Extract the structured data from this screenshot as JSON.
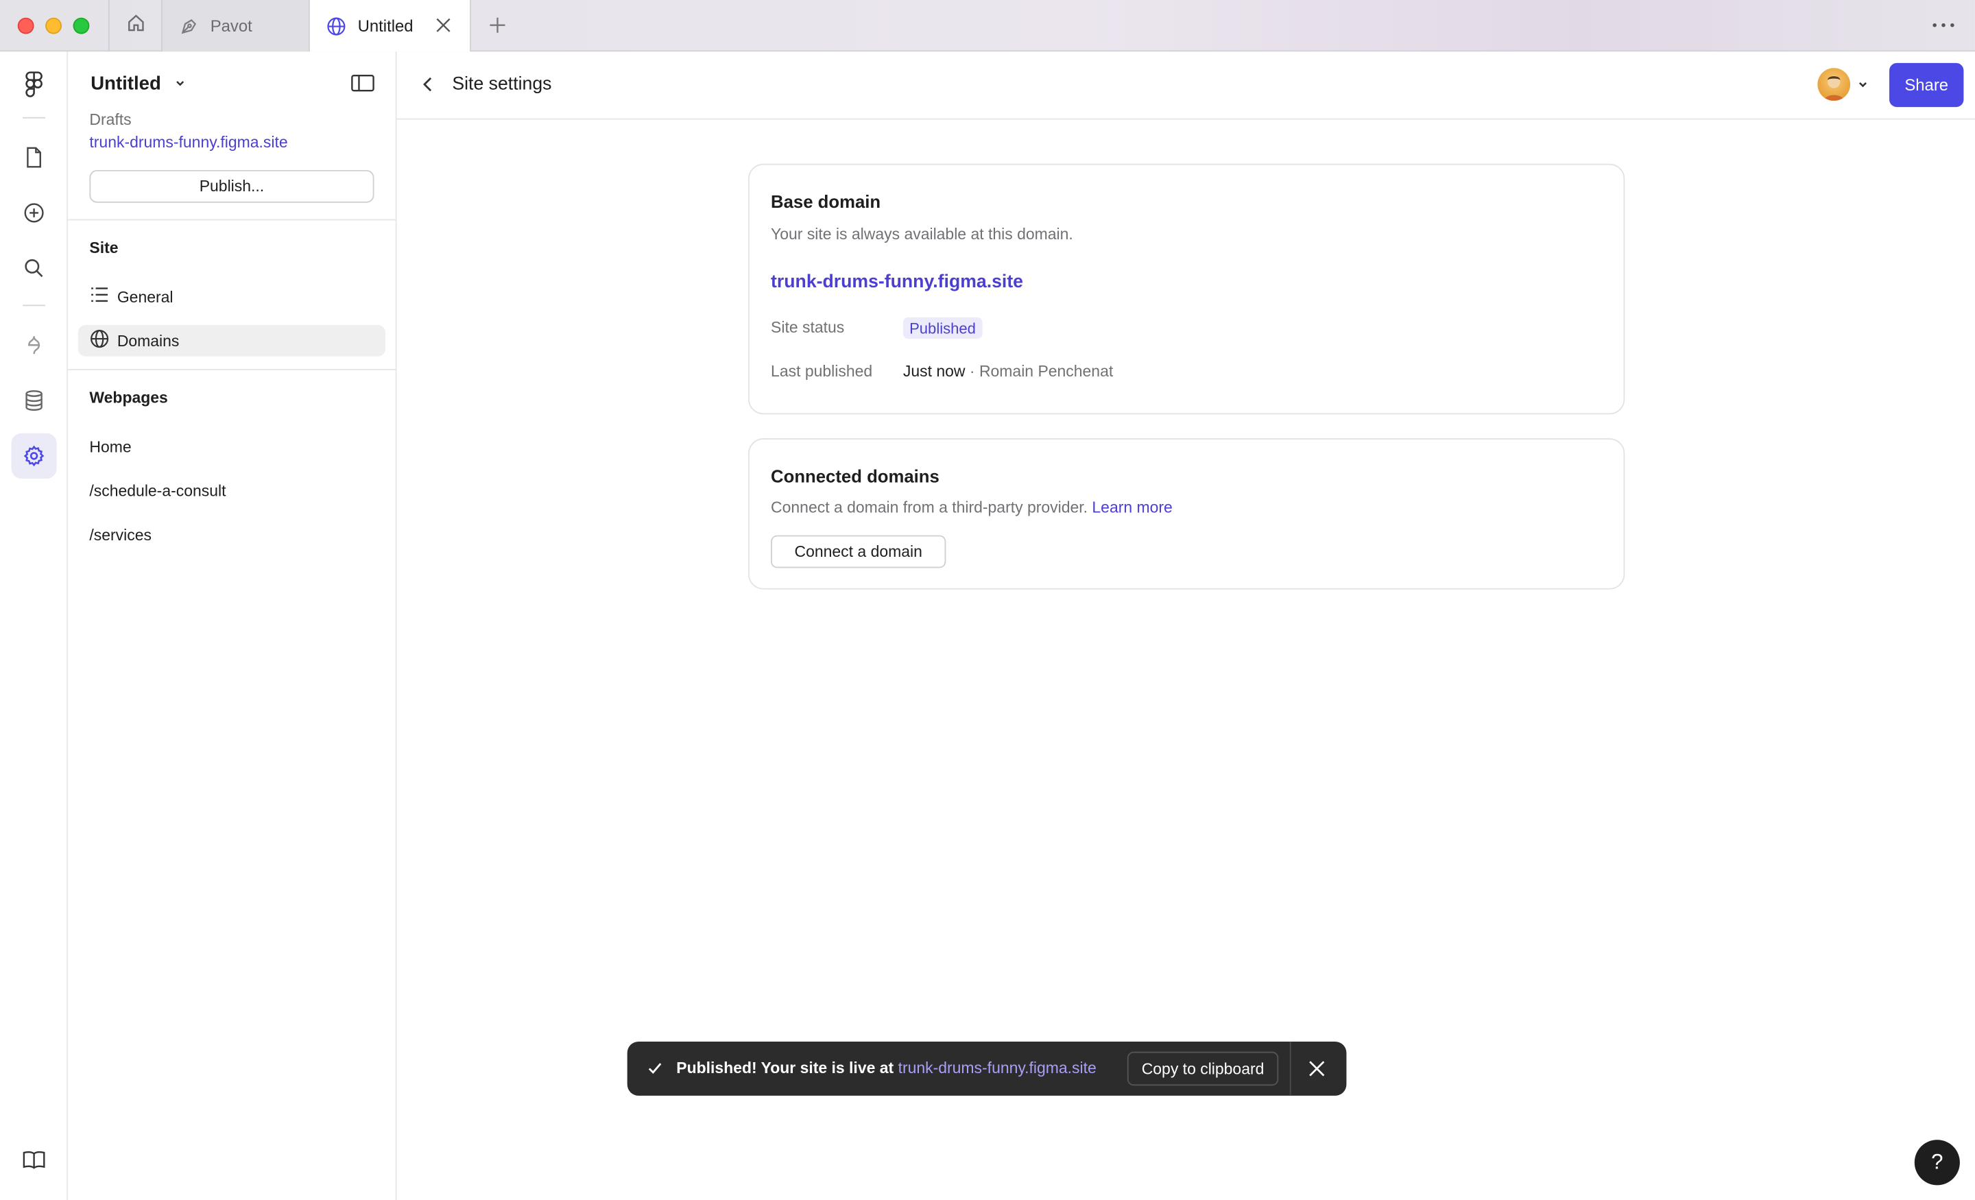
{
  "tabs": {
    "pavot": "Pavot",
    "active": "Untitled"
  },
  "sidebar": {
    "file_title": "Untitled",
    "drafts": "Drafts",
    "site_url": "trunk-drums-funny.figma.site",
    "publish_label": "Publish...",
    "site_heading": "Site",
    "site_items": [
      {
        "label": "General",
        "icon": "list-icon"
      },
      {
        "label": "Domains",
        "icon": "globe-icon",
        "selected": true
      }
    ],
    "webpages_heading": "Webpages",
    "pages": [
      "Home",
      "/schedule-a-consult",
      "/services"
    ]
  },
  "header": {
    "title": "Site settings",
    "share_label": "Share"
  },
  "base_domain": {
    "title": "Base domain",
    "description": "Your site is always available at this domain.",
    "domain": "trunk-drums-funny.figma.site",
    "status_label": "Site status",
    "status_value": "Published",
    "last_published_label": "Last published",
    "last_published_time": "Just now",
    "last_published_sep": " · ",
    "last_published_by": "Romain Penchenat"
  },
  "connected_domains": {
    "title": "Connected domains",
    "description": "Connect a domain from a third-party provider.",
    "learn_more": "Learn more",
    "connect_label": "Connect a domain"
  },
  "toast": {
    "message": "Published! Your site is live at",
    "link": "trunk-drums-funny.figma.site",
    "copy_label": "Copy to clipboard"
  },
  "help_label": "?",
  "colors": {
    "accent": "#4b48e6",
    "link": "#4c3fcf",
    "toast_bg": "#2c2c2c"
  }
}
